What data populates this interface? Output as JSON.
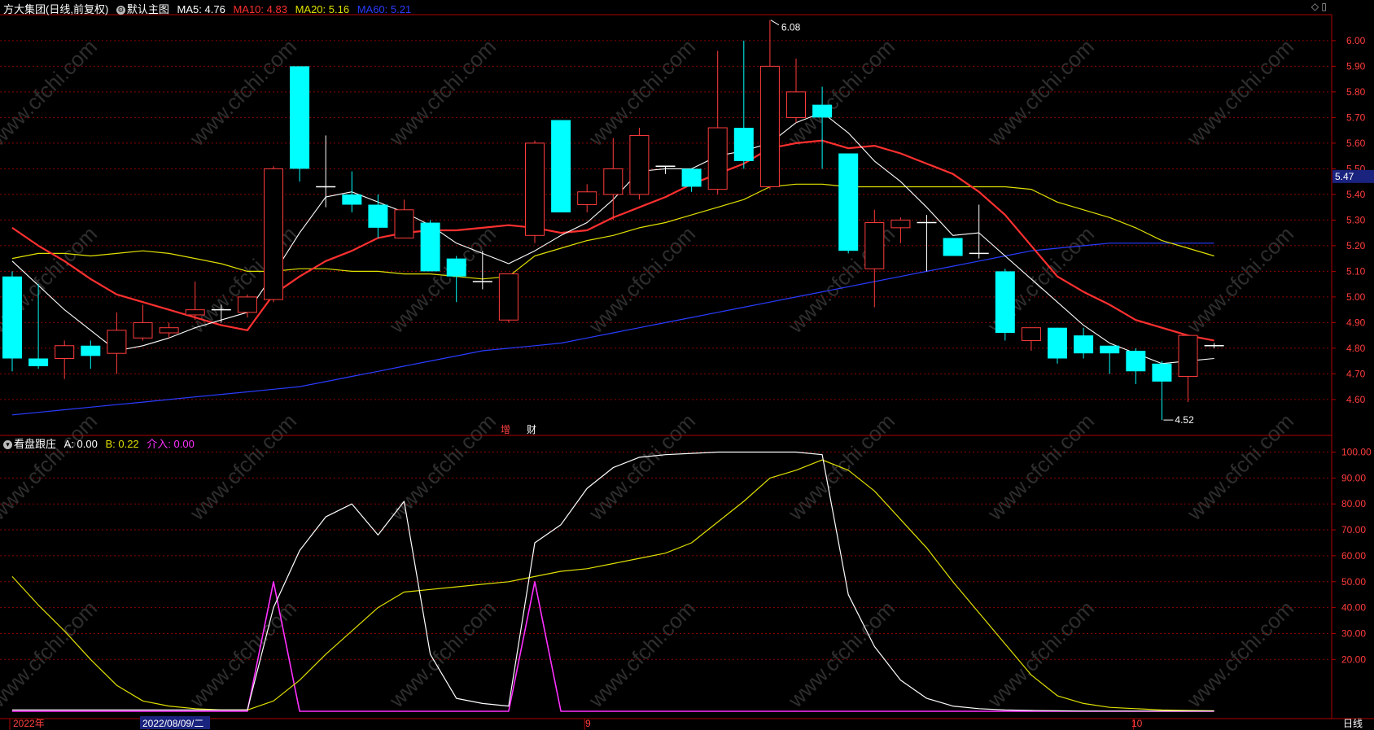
{
  "header": {
    "stock_name": "方大集团(日线,前复权)",
    "main_indicator": "默认主图",
    "ma5": {
      "label": "MA5: 4.76",
      "color": "#ffffff"
    },
    "ma10": {
      "label": "MA10: 4.83",
      "color": "#ff3030"
    },
    "ma20": {
      "label": "MA20: 5.16",
      "color": "#e0e000"
    },
    "ma60": {
      "label": "MA60: 5.21",
      "color": "#2a3cff"
    }
  },
  "sub_header": {
    "indicator": "看盘跟庄",
    "a": {
      "label": "A: 0.00",
      "color": "#ffffff"
    },
    "b": {
      "label": "B: 0.22",
      "color": "#e0e000"
    },
    "jieru": {
      "label": "介入: 0.00",
      "color": "#ff30ff"
    }
  },
  "corner_icons": [
    "diamond-icon",
    "window-icon"
  ],
  "watermark": "www.cfchi.com",
  "markers": {
    "zeng": "增",
    "cai": "财"
  },
  "bottom_labels": {
    "year": "2022年",
    "date": "2022/08/09/二",
    "sep": "9",
    "oct": "10",
    "period": "日线"
  },
  "colors": {
    "up": "#ff3c3c",
    "down": "#00ffff",
    "grid": "#8b0000",
    "axis_text": "#ff3c3c"
  },
  "chart_data": [
    {
      "type": "candlestick",
      "yticks": [
        4.6,
        4.7,
        4.8,
        4.9,
        5.0,
        5.1,
        5.2,
        5.3,
        5.4,
        5.5,
        5.6,
        5.7,
        5.8,
        5.9,
        6.0
      ],
      "ylim": [
        4.45,
        6.1
      ],
      "current_price": "5.47",
      "high_annotation": "6.08",
      "low_annotation": "4.52",
      "ohlc": [
        [
          5.08,
          5.1,
          4.71,
          4.76
        ],
        [
          4.76,
          5.05,
          4.72,
          4.73
        ],
        [
          4.76,
          4.83,
          4.68,
          4.81
        ],
        [
          4.81,
          4.83,
          4.72,
          4.77
        ],
        [
          4.78,
          4.94,
          4.7,
          4.87
        ],
        [
          4.84,
          4.97,
          4.83,
          4.9
        ],
        [
          4.86,
          4.9,
          4.84,
          4.88
        ],
        [
          4.93,
          5.06,
          4.91,
          4.95
        ],
        [
          4.95,
          4.97,
          4.9,
          4.95
        ],
        [
          4.94,
          5.01,
          4.92,
          5.0
        ],
        [
          4.99,
          5.51,
          4.98,
          5.5
        ],
        [
          5.9,
          5.9,
          5.45,
          5.5
        ],
        [
          5.43,
          5.63,
          5.35,
          5.43
        ],
        [
          5.4,
          5.49,
          5.33,
          5.36
        ],
        [
          5.36,
          5.4,
          5.23,
          5.27
        ],
        [
          5.23,
          5.38,
          5.23,
          5.34
        ],
        [
          5.29,
          5.3,
          5.1,
          5.1
        ],
        [
          5.15,
          5.16,
          4.98,
          5.08
        ],
        [
          5.06,
          5.18,
          5.03,
          5.06
        ],
        [
          4.91,
          5.09,
          4.9,
          5.09
        ],
        [
          5.24,
          5.61,
          5.21,
          5.6
        ],
        [
          5.69,
          5.69,
          5.33,
          5.33
        ],
        [
          5.36,
          5.44,
          5.33,
          5.41
        ],
        [
          5.4,
          5.62,
          5.3,
          5.5
        ],
        [
          5.4,
          5.66,
          5.38,
          5.63
        ],
        [
          5.51,
          5.51,
          5.48,
          5.51
        ],
        [
          5.5,
          5.5,
          5.41,
          5.43
        ],
        [
          5.42,
          5.96,
          5.4,
          5.66
        ],
        [
          5.66,
          6.0,
          5.5,
          5.53
        ],
        [
          5.43,
          6.08,
          5.42,
          5.9
        ],
        [
          5.7,
          5.93,
          5.68,
          5.8
        ],
        [
          5.75,
          5.82,
          5.5,
          5.7
        ],
        [
          5.56,
          5.56,
          5.17,
          5.18
        ],
        [
          5.11,
          5.34,
          4.96,
          5.29
        ],
        [
          5.27,
          5.31,
          5.21,
          5.3
        ],
        [
          5.29,
          5.32,
          5.1,
          5.29
        ],
        [
          5.23,
          5.23,
          5.16,
          5.16
        ],
        [
          5.17,
          5.36,
          5.15,
          5.17
        ],
        [
          5.1,
          5.11,
          4.83,
          4.86
        ],
        [
          4.83,
          4.88,
          4.79,
          4.88
        ],
        [
          4.88,
          4.88,
          4.74,
          4.76
        ],
        [
          4.85,
          4.88,
          4.76,
          4.78
        ],
        [
          4.81,
          4.81,
          4.7,
          4.78
        ],
        [
          4.79,
          4.8,
          4.66,
          4.71
        ],
        [
          4.74,
          4.75,
          4.52,
          4.67
        ],
        [
          4.69,
          4.85,
          4.59,
          4.85
        ],
        [
          4.81,
          4.82,
          4.8,
          4.81
        ]
      ],
      "ma5": [
        5.14,
        null,
        4.95,
        4.87,
        4.79,
        4.81,
        4.84,
        4.88,
        4.91,
        4.94,
        5.09,
        5.25,
        5.39,
        5.41,
        5.37,
        5.33,
        5.28,
        5.21,
        5.17,
        5.13,
        5.18,
        5.24,
        5.29,
        5.38,
        5.49,
        5.5,
        5.5,
        5.55,
        5.57,
        5.6,
        5.68,
        5.72,
        5.64,
        5.53,
        5.45,
        5.35,
        5.24,
        5.25,
        5.16,
        5.07,
        4.98,
        4.89,
        4.82,
        4.78,
        4.74,
        4.75,
        4.76
      ],
      "ma10": [
        5.27,
        5.2,
        5.14,
        5.07,
        5.01,
        4.98,
        4.95,
        4.92,
        4.89,
        4.87,
        5.01,
        5.08,
        5.14,
        5.18,
        5.23,
        5.25,
        5.26,
        5.26,
        5.27,
        5.28,
        5.27,
        5.25,
        5.26,
        5.31,
        5.35,
        5.39,
        5.44,
        5.48,
        5.52,
        5.58,
        5.6,
        5.61,
        5.58,
        5.59,
        5.56,
        5.52,
        5.48,
        5.41,
        5.32,
        5.2,
        5.08,
        5.02,
        4.97,
        4.91,
        4.88,
        4.85,
        4.83
      ],
      "ma20": [
        5.15,
        5.17,
        5.17,
        5.16,
        5.17,
        5.18,
        5.17,
        5.15,
        5.13,
        5.1,
        5.1,
        5.11,
        5.11,
        5.1,
        5.1,
        5.09,
        5.09,
        5.08,
        5.07,
        5.08,
        5.16,
        5.19,
        5.22,
        5.24,
        5.27,
        5.29,
        5.32,
        5.35,
        5.38,
        5.43,
        5.44,
        5.44,
        5.43,
        5.43,
        5.43,
        5.43,
        5.43,
        5.43,
        5.43,
        5.42,
        5.37,
        5.34,
        5.31,
        5.27,
        5.22,
        5.19,
        5.16
      ],
      "ma60": [
        4.54,
        4.55,
        4.56,
        4.57,
        4.58,
        4.59,
        4.6,
        4.61,
        4.62,
        4.63,
        4.64,
        4.65,
        4.67,
        4.69,
        4.71,
        4.73,
        4.75,
        4.77,
        4.79,
        4.8,
        4.81,
        4.82,
        4.84,
        4.86,
        4.88,
        4.9,
        4.92,
        4.94,
        4.96,
        4.98,
        5.0,
        5.02,
        5.04,
        5.06,
        5.08,
        5.1,
        5.12,
        5.14,
        5.16,
        5.18,
        5.19,
        5.2,
        5.21,
        5.21,
        5.21,
        5.21,
        5.21
      ]
    },
    {
      "type": "line",
      "title": "看盘跟庄",
      "yticks": [
        20,
        30,
        40,
        50,
        60,
        70,
        80,
        90,
        100
      ],
      "ylim": [
        0,
        100
      ],
      "series": [
        {
          "name": "A",
          "color": "#ffffff",
          "values": [
            0.5,
            0.5,
            0.5,
            0.5,
            0.5,
            0.5,
            0.5,
            0.5,
            0.5,
            0.5,
            40,
            62,
            75,
            80,
            68,
            81,
            22,
            5,
            3,
            2,
            65,
            72,
            86,
            94,
            98,
            99,
            99.5,
            100,
            100,
            100,
            100,
            99,
            45,
            25,
            12,
            5,
            2,
            1,
            0.5,
            0.3,
            0.2,
            0.1,
            0.1,
            0.1,
            0.1,
            0.1,
            0.1
          ]
        },
        {
          "name": "B",
          "color": "#e0e000",
          "values": [
            52,
            41,
            31,
            20,
            10,
            4,
            2,
            1,
            0.5,
            0.5,
            4,
            12,
            22,
            31,
            40,
            46,
            47,
            48,
            49,
            50,
            52,
            54,
            55,
            57,
            59,
            61,
            65,
            73,
            81,
            90,
            93,
            97,
            93,
            85,
            74,
            63,
            50,
            38,
            26,
            14,
            6,
            3,
            1.5,
            1,
            0.5,
            0.3,
            0.2
          ]
        },
        {
          "name": "介入",
          "color": "#ff30ff",
          "values": [
            0,
            0,
            0,
            0,
            0,
            0,
            0,
            0,
            0,
            0,
            50,
            0,
            0,
            0,
            0,
            0,
            0,
            0,
            0,
            0,
            50,
            0,
            0,
            0,
            0,
            0,
            0,
            0,
            0,
            0,
            0,
            0,
            0,
            0,
            0,
            0,
            0,
            0,
            0,
            0,
            0,
            0,
            0,
            0,
            0,
            0,
            0
          ]
        }
      ]
    }
  ]
}
